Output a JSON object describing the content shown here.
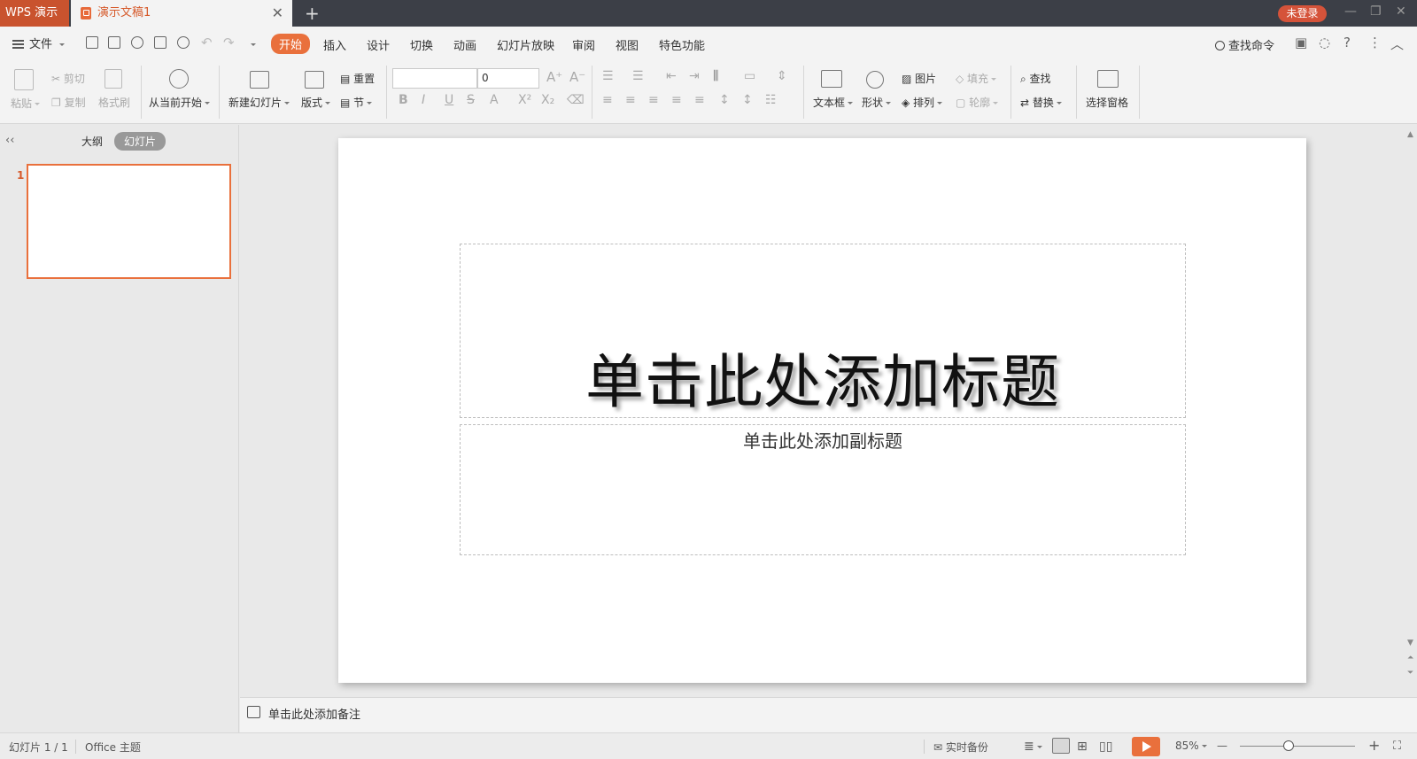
{
  "titlebar": {
    "app_name": "WPS 演示",
    "doc_tab": "演示文稿1",
    "close_glyph": "✕",
    "new_tab_glyph": "+",
    "login": "未登录",
    "minimize": "—",
    "restore": "❐",
    "close": "✕"
  },
  "menubar": {
    "file": "文件",
    "tabs": [
      "开始",
      "插入",
      "设计",
      "切换",
      "动画",
      "幻灯片放映",
      "审阅",
      "视图",
      "特色功能"
    ],
    "search_command": "查找命令"
  },
  "ribbon": {
    "paste": "粘贴",
    "cut": "剪切",
    "copy": "复制",
    "format_painter": "格式刷",
    "from_current": "从当前开始",
    "new_slide": "新建幻灯片",
    "layout": "版式",
    "reset": "重置",
    "section": "节",
    "font_name": "",
    "font_size": "0",
    "text_box": "文本框",
    "shape": "形状",
    "picture": "图片",
    "arrange": "排列",
    "fill": "填充",
    "outline": "轮廓",
    "find": "查找",
    "replace": "替换",
    "select_pane": "选择窗格"
  },
  "left_panel": {
    "collapse": "‹‹",
    "outline_tab": "大纲",
    "slides_tab": "幻灯片",
    "slide_number": "1"
  },
  "slide": {
    "title_placeholder": "单击此处添加标题",
    "subtitle_placeholder": "单击此处添加副标题"
  },
  "notes": {
    "placeholder": "单击此处添加备注"
  },
  "statusbar": {
    "slide_counter": "幻灯片 1 / 1",
    "theme": "Office 主题",
    "backup": "实时备份",
    "zoom": "85%",
    "zoom_minus": "—",
    "zoom_plus": "+"
  },
  "colors": {
    "accent": "#e9703c",
    "titlebar_bg": "#3c3f47",
    "app_tab_bg": "#c9532e",
    "login_badge": "#d5533a"
  }
}
